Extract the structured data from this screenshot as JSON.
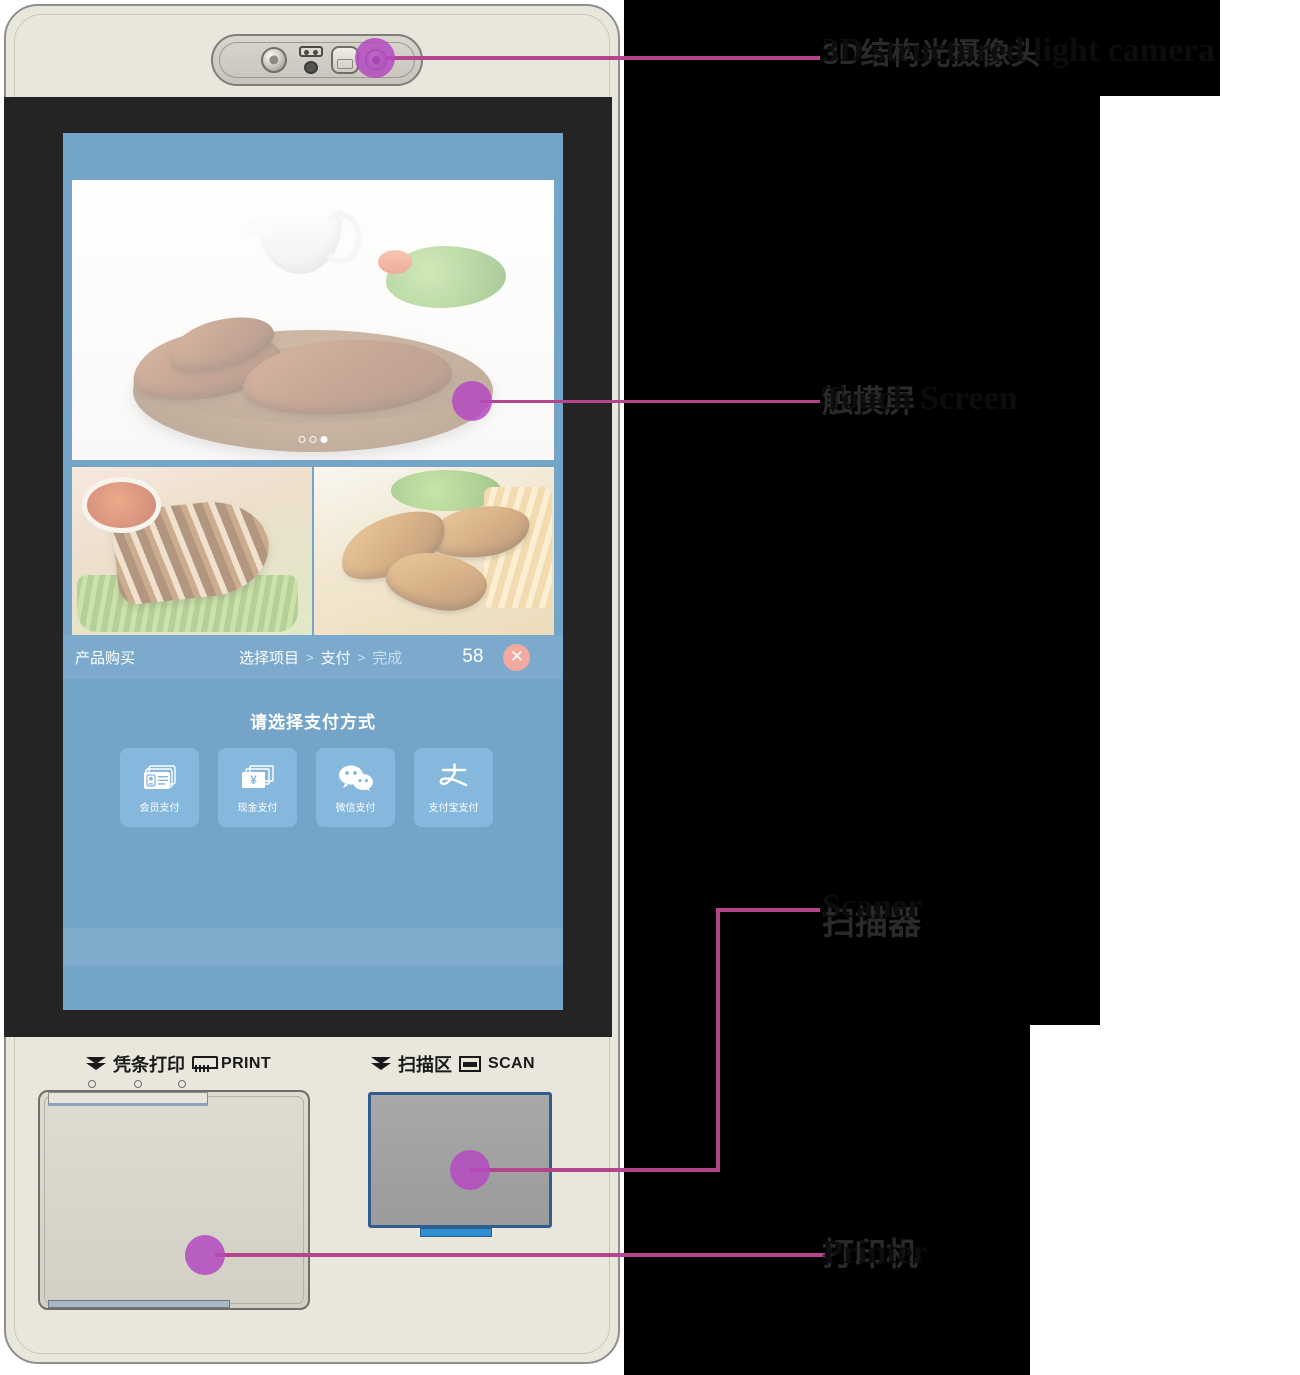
{
  "device": {
    "name": "self-service ordering kiosk",
    "body_color": "#e9e7dc",
    "bezel_color": "#242424",
    "screen_color": "#74a5c9"
  },
  "callouts": [
    {
      "id": "camera",
      "cn": "3D结构光摄像头",
      "en": "3D structured light camera",
      "en_line2": "camera"
    },
    {
      "id": "touchscreen",
      "cn": "触摸屏",
      "en": "Touch Screen"
    },
    {
      "id": "scanner",
      "cn": "扫描器",
      "en": "Scaner"
    },
    {
      "id": "printer",
      "cn": "打印机",
      "en": "Printer"
    }
  ],
  "screen": {
    "carousel": {
      "hero_alt": "grilled meat platter on wooden board",
      "dots": 3,
      "active_dot": 3
    },
    "thumbnails": [
      {
        "alt": "sliced roast pork with chili dipping sauce"
      },
      {
        "alt": "fried chicken drumsticks with fries and salad"
      }
    ],
    "breadcrumb": {
      "title": "产品购买",
      "steps": [
        {
          "label": "选择项目",
          "active": true
        },
        {
          "label": "支付",
          "active": true
        },
        {
          "label": "完成",
          "active": false
        }
      ],
      "separator": ">",
      "count": "58",
      "close_label": "✕"
    },
    "payment": {
      "title": "请选择支付方式",
      "methods": [
        {
          "label": "会员支付",
          "icon": "member-card-icon"
        },
        {
          "label": "现金支付",
          "icon": "cash-yuan-icon"
        },
        {
          "label": "微信支付",
          "icon": "wechat-icon"
        },
        {
          "label": "支付宝支付",
          "icon": "alipay-icon"
        }
      ]
    }
  },
  "hardware_labels": {
    "print": {
      "cn": "凭条打印",
      "en": "PRINT",
      "icon": "printer-icon",
      "chevron": "chevron-down-icon"
    },
    "scan": {
      "cn": "扫描区",
      "en": "SCAN",
      "icon": "scanner-icon",
      "chevron": "chevron-down-icon"
    }
  },
  "colors": {
    "callout_line": "#b4448b",
    "callout_dot": "#b44ac0",
    "accent_blue": "#86b7dd",
    "close_red": "#f3a8a0"
  }
}
